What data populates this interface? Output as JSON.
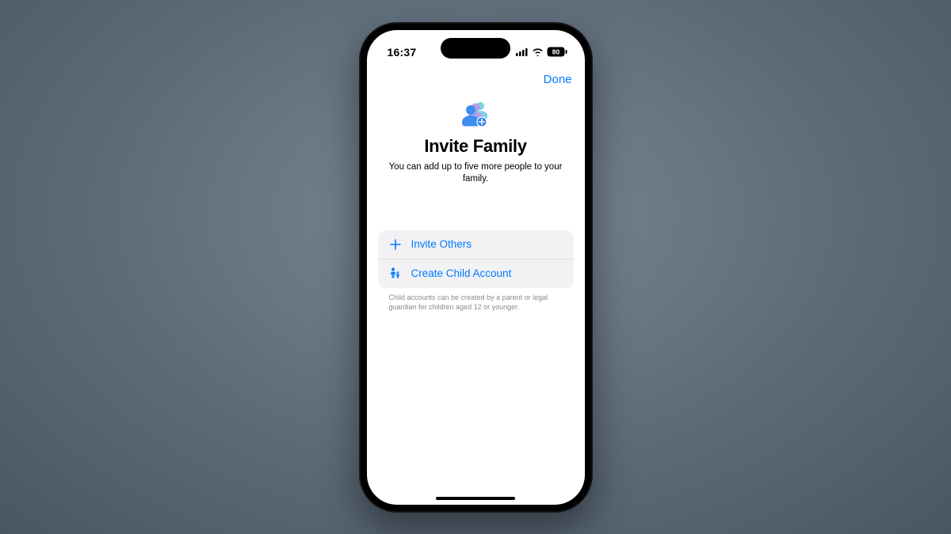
{
  "status": {
    "time": "16:37",
    "battery_level": "80"
  },
  "nav": {
    "done_label": "Done"
  },
  "page": {
    "title": "Invite Family",
    "subtitle": "You can add up to five more people to your family."
  },
  "options": {
    "invite_label": "Invite Others",
    "child_label": "Create Child Account"
  },
  "footer": {
    "note": "Child accounts can be created by a parent or legal guardian for children aged 12 or younger."
  },
  "colors": {
    "accent": "#007aff"
  }
}
